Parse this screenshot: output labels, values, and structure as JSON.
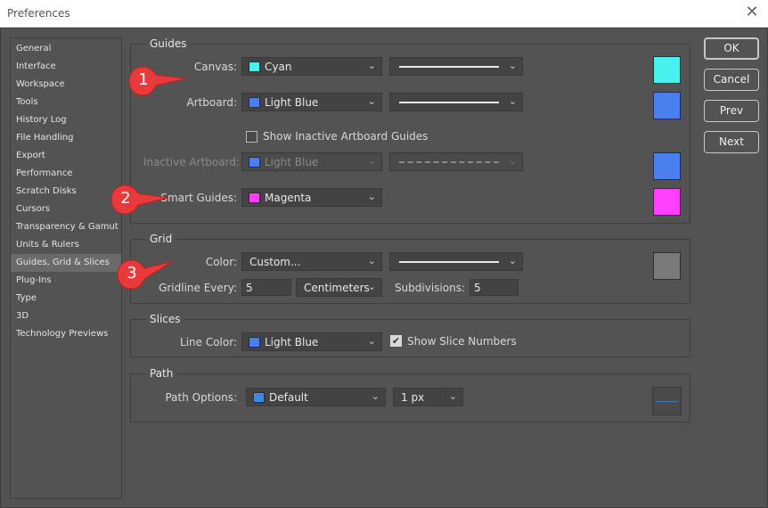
{
  "window": {
    "title": "Preferences",
    "close_glyph": "✕"
  },
  "sidebar": {
    "items": [
      {
        "label": "General"
      },
      {
        "label": "Interface"
      },
      {
        "label": "Workspace"
      },
      {
        "label": "Tools"
      },
      {
        "label": "History Log"
      },
      {
        "label": "File Handling"
      },
      {
        "label": "Export"
      },
      {
        "label": "Performance"
      },
      {
        "label": "Scratch Disks"
      },
      {
        "label": "Cursors"
      },
      {
        "label": "Transparency & Gamut"
      },
      {
        "label": "Units & Rulers"
      },
      {
        "label": "Guides, Grid & Slices",
        "active": true
      },
      {
        "label": "Plug-Ins"
      },
      {
        "label": "Type"
      },
      {
        "label": "3D"
      },
      {
        "label": "Technology Previews"
      }
    ]
  },
  "guides": {
    "title": "Guides",
    "canvas": {
      "label": "Canvas:",
      "color": "Cyan",
      "swatch": "#48f0f0"
    },
    "artboard": {
      "label": "Artboard:",
      "color": "Light Blue",
      "swatch": "#4a7ff0"
    },
    "show_inactive": {
      "label": "Show Inactive Artboard Guides",
      "checked": false
    },
    "inactive_artboard": {
      "label": "Inactive Artboard:",
      "color": "Light Blue",
      "swatch": "#4a7ff0"
    },
    "smart_guides": {
      "label": "Smart Guides:",
      "color": "Magenta",
      "swatch": "#ff40ff"
    }
  },
  "grid": {
    "title": "Grid",
    "color": {
      "label": "Color:",
      "value": "Custom...",
      "swatch": "#7a7a7a"
    },
    "gridline": {
      "label": "Gridline Every:",
      "value": "5",
      "unit": "Centimeters"
    },
    "subdivisions": {
      "label": "Subdivisions:",
      "value": "5"
    }
  },
  "slices": {
    "title": "Slices",
    "line_color": {
      "label": "Line Color:",
      "color": "Light Blue",
      "swatch": "#4a7ff0"
    },
    "show_numbers": {
      "label": "Show Slice Numbers",
      "checked": true,
      "glyph": "✔"
    }
  },
  "path": {
    "title": "Path",
    "options": {
      "label": "Path Options:",
      "color": "Default",
      "swatch": "#3a8ae8",
      "width": "1 px"
    }
  },
  "buttons": {
    "ok": "OK",
    "cancel": "Cancel",
    "prev": "Prev",
    "next": "Next"
  },
  "callouts": [
    {
      "number": "1"
    },
    {
      "number": "2"
    },
    {
      "number": "3"
    }
  ],
  "colors": {
    "callout": "#e83a3a",
    "background": "#535353"
  },
  "icons": {
    "chevron": "⌄"
  }
}
